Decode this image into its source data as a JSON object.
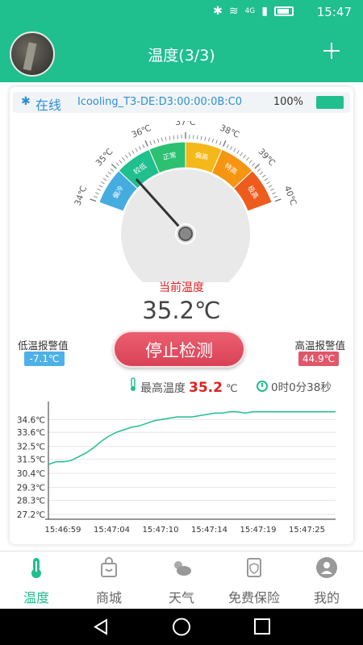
{
  "status_bar": {
    "time": "15:47",
    "network": "4G"
  },
  "header": {
    "title": "温度(3/3)",
    "add_icon": "plus-icon"
  },
  "device": {
    "status": "在线",
    "name": "Icooling_T3-DE:D3:00:00:0B:C0",
    "battery": "100%",
    "battery_level": 1.0
  },
  "gauge": {
    "scale_labels": [
      "34℃",
      "35℃",
      "36℃",
      "37℃",
      "38℃",
      "39℃",
      "40℃"
    ],
    "zones": [
      {
        "label": "偏冷",
        "color": "#45ace0"
      },
      {
        "label": "较低",
        "color": "#1fbf8e"
      },
      {
        "label": "正常",
        "color": "#2cc071"
      },
      {
        "label": "偏高",
        "color": "#f4b81a"
      },
      {
        "label": "特高",
        "color": "#f59512"
      },
      {
        "label": "极高",
        "color": "#ee5c1d"
      }
    ],
    "needle_value": 35.2
  },
  "current": {
    "label": "当前温度",
    "value": "35.2℃"
  },
  "low_alarm": {
    "label": "低温报警值",
    "value": "-7.1℃"
  },
  "high_alarm": {
    "label": "高温报警值",
    "value": "44.9℃"
  },
  "stop_button": "停止检测",
  "max_temp": {
    "label": "最高温度",
    "value": "35.2",
    "unit": "℃"
  },
  "elapsed": "0时0分38秒",
  "chart_data": {
    "type": "line",
    "title": "",
    "xlabel": "",
    "ylabel": "",
    "y_tick_labels": [
      "34.6℃",
      "33.6℃",
      "32.5℃",
      "31.5℃",
      "30.4℃",
      "29.3℃",
      "28.3℃",
      "27.2℃"
    ],
    "x_tick_labels": [
      "15:46:59",
      "15:47:04",
      "15:47:10",
      "15:47:14",
      "15:47:19",
      "15:47:25"
    ],
    "ylim": [
      27.2,
      35.5
    ],
    "x": [
      0,
      1,
      2,
      3,
      4,
      5,
      6,
      7,
      8,
      9,
      10,
      11,
      12,
      13,
      14,
      15,
      16,
      17,
      18,
      19,
      20,
      21,
      22,
      23,
      24,
      25,
      26,
      27,
      28,
      29,
      30,
      31,
      32,
      33,
      34,
      35,
      36,
      37,
      38
    ],
    "series": [
      {
        "color": "#1fbf8e",
        "values": [
          31.1,
          31.3,
          31.3,
          31.4,
          31.7,
          32.0,
          32.4,
          32.9,
          33.3,
          33.6,
          33.8,
          34.0,
          34.1,
          34.3,
          34.5,
          34.6,
          34.7,
          34.8,
          34.8,
          34.8,
          34.9,
          35.0,
          35.1,
          35.1,
          35.2,
          35.2,
          35.1,
          35.2,
          35.2,
          35.2,
          35.2,
          35.2,
          35.2,
          35.2,
          35.2,
          35.2,
          35.2,
          35.2,
          35.2
        ]
      }
    ],
    "grid": true
  },
  "nav": [
    {
      "label": "温度",
      "icon": "thermometer-icon",
      "active": true
    },
    {
      "label": "商城",
      "icon": "shopping-bag-icon",
      "active": false
    },
    {
      "label": "天气",
      "icon": "weather-icon",
      "active": false
    },
    {
      "label": "免费保险",
      "icon": "insurance-icon",
      "active": false
    },
    {
      "label": "我的",
      "icon": "profile-icon",
      "active": false
    }
  ],
  "colors": {
    "accent": "#1fbf8e",
    "alert": "#e02020",
    "device_text": "#2c8fd6"
  }
}
